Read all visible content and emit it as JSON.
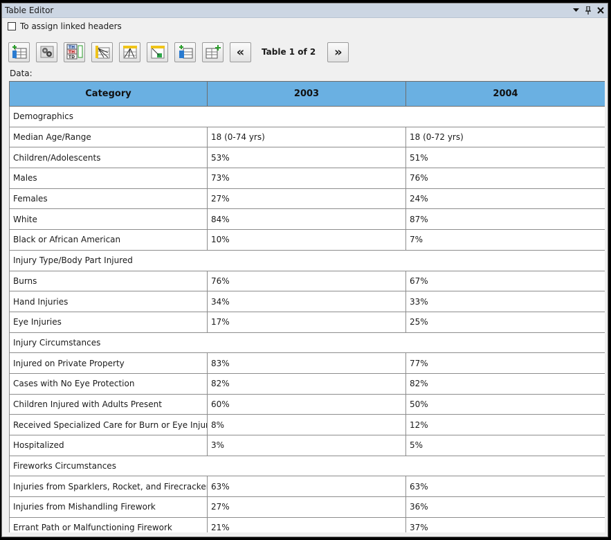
{
  "window": {
    "title": "Table Editor"
  },
  "options": {
    "assign_linked_headers_label": "To assign linked headers"
  },
  "toolbar": {
    "buttons": [
      {
        "icon": "insert-row-icon"
      },
      {
        "icon": "link-settings-icon"
      },
      {
        "icon": "header-types-icon"
      },
      {
        "icon": "assign-headers-icon"
      },
      {
        "icon": "header-lines-icon"
      },
      {
        "icon": "mark-cell-icon"
      },
      {
        "icon": "insert-column-icon"
      },
      {
        "icon": "add-table-icon"
      }
    ],
    "table_indicator": "Table 1 of 2",
    "prev_icon": "double-chevron-left-icon",
    "next_icon": "double-chevron-right-icon"
  },
  "data_label": "Data:",
  "table": {
    "headers": [
      "Category",
      "2003",
      "2004"
    ],
    "rows": [
      {
        "type": "section",
        "cells": [
          "Demographics"
        ]
      },
      {
        "type": "data",
        "cells": [
          "Median Age/Range",
          "18 (0-74 yrs)",
          "18 (0-72 yrs)"
        ]
      },
      {
        "type": "data",
        "cells": [
          "Children/Adolescents",
          "53%",
          "51%"
        ]
      },
      {
        "type": "data",
        "cells": [
          "Males",
          "73%",
          "76%"
        ]
      },
      {
        "type": "data",
        "cells": [
          "Females",
          "27%",
          "24%"
        ]
      },
      {
        "type": "data",
        "cells": [
          "White",
          "84%",
          "87%"
        ]
      },
      {
        "type": "data",
        "cells": [
          "Black or African American",
          "10%",
          "7%"
        ]
      },
      {
        "type": "section",
        "cells": [
          "Injury Type/Body Part Injured"
        ]
      },
      {
        "type": "data",
        "cells": [
          "Burns",
          "76%",
          "67%"
        ]
      },
      {
        "type": "data",
        "cells": [
          "Hand Injuries",
          "34%",
          "33%"
        ]
      },
      {
        "type": "data",
        "cells": [
          "Eye Injuries",
          "17%",
          "25%"
        ]
      },
      {
        "type": "section",
        "cells": [
          "Injury Circumstances"
        ]
      },
      {
        "type": "data",
        "cells": [
          "Injured on Private Property",
          "83%",
          "77%"
        ]
      },
      {
        "type": "data",
        "cells": [
          "Cases with No Eye Protection",
          "82%",
          "82%"
        ]
      },
      {
        "type": "data",
        "cells": [
          "Children Injured with Adults Present",
          "60%",
          "50%"
        ]
      },
      {
        "type": "data",
        "cells": [
          "Received Specialized Care for Burn or Eye Injuries",
          "8%",
          "12%"
        ]
      },
      {
        "type": "data",
        "cells": [
          "Hospitalized",
          "3%",
          "5%"
        ]
      },
      {
        "type": "section",
        "cells": [
          "Fireworks Circumstances"
        ]
      },
      {
        "type": "data",
        "cells": [
          "Injuries from Sparklers, Rocket, and Firecrackers",
          "63%",
          "63%"
        ]
      },
      {
        "type": "data",
        "cells": [
          "Injuries from Mishandling Firework",
          "27%",
          "36%"
        ]
      },
      {
        "type": "data",
        "cells": [
          "Errant Path or Malfunctioning Firework",
          "21%",
          "37%"
        ]
      }
    ]
  },
  "colors": {
    "header_bg": "#6ab0e2",
    "titlebar_bg": "#ccd6e3"
  }
}
